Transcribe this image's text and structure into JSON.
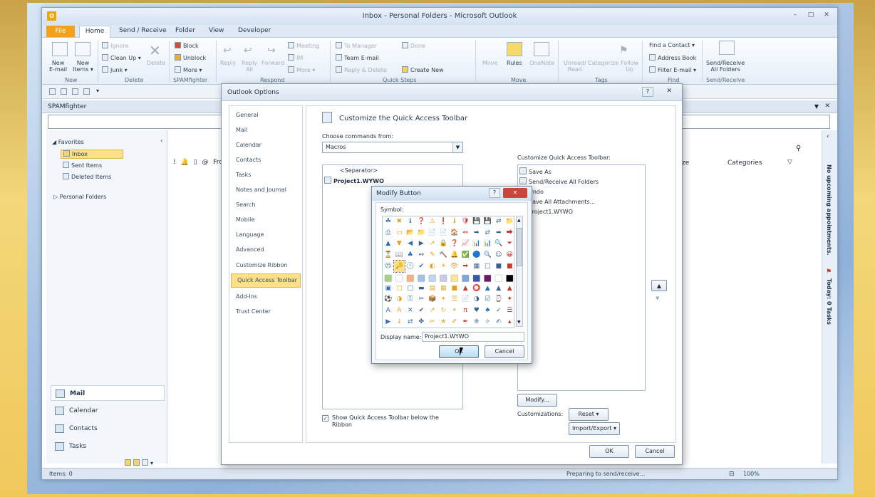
{
  "window": {
    "title": "Inbox - Personal Folders - Microsoft Outlook"
  },
  "window_buttons": [
    "–",
    "□",
    "✕"
  ],
  "tabs": [
    "File",
    "Home",
    "Send / Receive",
    "Folder",
    "View",
    "Developer"
  ],
  "ribbon": {
    "new": {
      "new_email": "New\nE-mail",
      "new_items": "New\nItems ▾",
      "group": "New"
    },
    "delete": {
      "ignore": "Ignore",
      "clean_up": "Clean Up ▾",
      "junk": "Junk ▾",
      "delete": "Delete",
      "group": "Delete"
    },
    "spam": {
      "block": "Block",
      "unblock": "Unblock",
      "more": "More ▾",
      "group": "SPAMfighter"
    },
    "respond": {
      "reply": "Reply",
      "reply_all": "Reply\nAll",
      "forward": "Forward",
      "meeting": "Meeting",
      "im": "IM",
      "more": "More ▾",
      "group": "Respond"
    },
    "quick_steps": {
      "to_manager": "To Manager",
      "team_email": "Team E-mail",
      "reply_delete": "Reply & Delete",
      "done": "Done",
      "create_new": "Create New",
      "group": "Quick Steps"
    },
    "move": {
      "move": "Move",
      "rules": "Rules",
      "onenote": "OneNote",
      "group": "Move"
    },
    "tags": {
      "unread_read": "Unread/\nRead",
      "categorize": "Categorize",
      "follow_up": "Follow\nUp",
      "group": "Tags"
    },
    "find": {
      "find_contact": "Find a Contact ▾",
      "address_book": "Address Book",
      "filter_email": "Filter E-mail ▾",
      "group": "Find"
    },
    "send_receive": {
      "label": "Send/Receive\nAll Folders",
      "group": "Send/Receive"
    }
  },
  "spam_bar": {
    "title": "SPAMfighter"
  },
  "nav": {
    "favorites": "Favorites",
    "inbox": "Inbox",
    "sent": "Sent Items",
    "deleted": "Deleted Items",
    "personal": "Personal Folders",
    "mail": "Mail",
    "calendar": "Calendar",
    "contacts": "Contacts",
    "tasks": "Tasks"
  },
  "list": {
    "from_header": "From",
    "size_header": "ze",
    "categories_header": "Categories"
  },
  "todo": {
    "appointments": "No upcoming appointments.",
    "tasks": "Today: 0 Tasks"
  },
  "status": {
    "items": "Items: 0",
    "sending": "Preparing to send/receive...",
    "zoom": "100%"
  },
  "options_dialog": {
    "title": "Outlook Options",
    "help": "?",
    "close": "✕",
    "nav": [
      "General",
      "Mail",
      "Calendar",
      "Contacts",
      "Tasks",
      "Notes and Journal",
      "Search",
      "Mobile",
      "Language",
      "Advanced",
      "Customize Ribbon",
      "Quick Access Toolbar",
      "Add-Ins",
      "Trust Center"
    ],
    "selected_nav": "Quick Access Toolbar",
    "heading": "Customize the Quick Access Toolbar",
    "choose_label": "Choose commands from:",
    "choose_value": "Macros",
    "left_items": [
      "<Separator>",
      "Project1.WYWO"
    ],
    "customize_label": "Customize Quick Access Toolbar:",
    "right_items": [
      "Save As",
      "Send/Receive All Folders",
      "Undo",
      "Save All Attachments...",
      "Project1.WYWO"
    ],
    "modify_btn": "Modify...",
    "customizations_label": "Customizations:",
    "reset_btn": "Reset ▾",
    "import_export_btn": "Import/Export ▾",
    "show_below_checkbox": "Show Quick Access Toolbar below the Ribbon",
    "ok": "OK",
    "cancel": "Cancel"
  },
  "modify_dialog": {
    "title": "Modify Button",
    "help": "?",
    "close": "✕",
    "symbol_label": "Symbol:",
    "display_name_label": "Display name:",
    "display_name_value": "Project1.WYWO",
    "ok": "OK",
    "cancel": "Cancel",
    "symbols": [
      "☘",
      "✖",
      "ℹ",
      "❓",
      "⚠",
      "❗",
      "ℹ",
      "🛡",
      "💾",
      "💾",
      "⇄",
      "📁",
      "⎙",
      "▭",
      "📂",
      "📁",
      "📄",
      "📄",
      "🏠",
      "⇔",
      "➡",
      "⇄",
      "➡",
      "⮕",
      "▲",
      "▼",
      "◀",
      "▶",
      "↗",
      "🔒",
      "❓",
      "📈",
      "📊",
      "📊",
      "🔍",
      "⏷",
      "⏳",
      "📖",
      "♣",
      "↔",
      "✎",
      "🔨",
      "🔔",
      "✅",
      "🔵",
      "🔍",
      "☺",
      "😀",
      "☹",
      "🔑",
      "🕒",
      "✔",
      "◐",
      "☀",
      "👁",
      "➡",
      "▦",
      "□",
      "■",
      "■",
      "■",
      "■",
      "■",
      "■",
      "■",
      "■",
      "■",
      "■",
      "■",
      "■",
      "■",
      "■",
      "▣",
      "□",
      "□",
      "▬",
      "▤",
      "▦",
      "■",
      "▲",
      "⭕",
      "▲",
      "▲",
      "▲",
      "⚽",
      "◑",
      "⚿",
      "✂",
      "📦",
      "✦",
      "☰",
      "📄",
      "◑",
      "☑",
      "⌚",
      "✦",
      "A",
      "A",
      "✕",
      "✔",
      "↗",
      "↻",
      "⌖",
      "π",
      "♥",
      "♠",
      "✓",
      "☰",
      "▶",
      "↓",
      "⇄",
      "✤",
      "✂",
      "★",
      "✐",
      "✒",
      "❈",
      "✧",
      "✍",
      "▴"
    ]
  },
  "colors": {
    "accent": "#f0a31a",
    "selection": "#fce08a",
    "swatches": [
      "#a8d08d",
      "#ffffff",
      "#f4b183",
      "#9dc3e6",
      "#bdd7ee",
      "#c9c9e8",
      "#ffe699",
      "#7fa8d8",
      "#3a56a7",
      "#6b1a6b",
      "#ffffff",
      "#000000"
    ]
  }
}
